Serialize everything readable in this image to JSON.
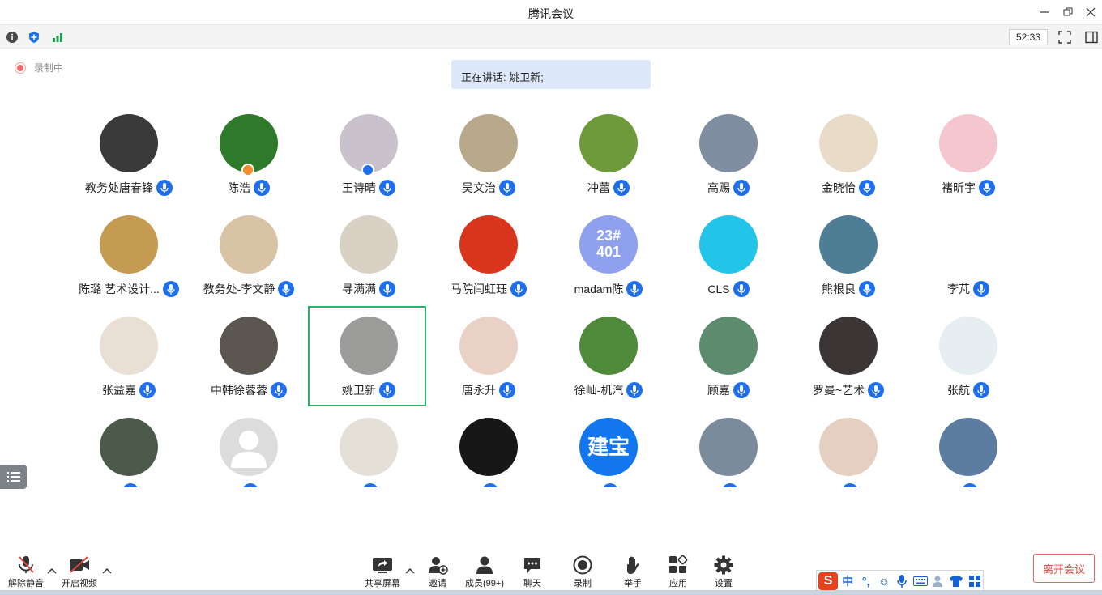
{
  "window": {
    "title": "腾讯会议"
  },
  "infobar": {
    "timer": "52:33"
  },
  "recording": {
    "label": "录制中"
  },
  "speaking": {
    "text": "正在讲话: 姚卫新;"
  },
  "participants": [
    {
      "name": "教务处唐春锋",
      "avatar_color": "#3a3a3a"
    },
    {
      "name": "陈浩",
      "avatar_color": "#2f7a2a",
      "badge": "host"
    },
    {
      "name": "王诗晴",
      "avatar_color": "#c9c2cc",
      "badge": "cohost"
    },
    {
      "name": "吴文治",
      "avatar_color": "#b7a98a"
    },
    {
      "name": "冲蕾",
      "avatar_color": "#6e9a3c"
    },
    {
      "name": "高赐",
      "avatar_color": "#7f8ea1"
    },
    {
      "name": "金晓怡",
      "avatar_color": "#e8dcc9"
    },
    {
      "name": "褚昕宇",
      "avatar_color": "#f4c7cf"
    },
    {
      "name": "陈璐 艺术设计...",
      "avatar_color": "#c59a52"
    },
    {
      "name": "教务处-李文静",
      "avatar_color": "#d8c3a5"
    },
    {
      "name": "寻满满",
      "avatar_color": "#d9d1c4"
    },
    {
      "name": "马院闫虹珏",
      "avatar_color": "#d9351c"
    },
    {
      "name": "madam陈",
      "avatar_color": "#8fa1ee",
      "avatar_text": "23# 401"
    },
    {
      "name": "CLS",
      "avatar_color": "#22c4e8"
    },
    {
      "name": "熊根良",
      "avatar_color": "#4d7e96"
    },
    {
      "name": "李芃",
      "avatar_color": "#ffffff"
    },
    {
      "name": "张益嘉",
      "avatar_color": "#e9dfd4"
    },
    {
      "name": "中韩徐蓉蓉",
      "avatar_color": "#5b5750"
    },
    {
      "name": "姚卫新",
      "avatar_color": "#9c9c9a",
      "active": true
    },
    {
      "name": "唐永升",
      "avatar_color": "#e9d2c5"
    },
    {
      "name": "徐屾-机汽",
      "avatar_color": "#4f8a3a"
    },
    {
      "name": "顾嘉",
      "avatar_color": "#5d8b6d"
    },
    {
      "name": "罗曼~艺术",
      "avatar_color": "#3b3535"
    },
    {
      "name": "张航",
      "avatar_color": "#e7eef2"
    },
    {
      "name": "",
      "avatar_color": "#4c5a4b"
    },
    {
      "name": "",
      "avatar_color": "#dcdcdc"
    },
    {
      "name": "",
      "avatar_color": "#e4e0d8"
    },
    {
      "name": "",
      "avatar_color": "#171717"
    },
    {
      "name": "",
      "avatar_color": "#1277ef",
      "avatar_text": "建宝"
    },
    {
      "name": "",
      "avatar_color": "#7a8c9b"
    },
    {
      "name": "",
      "avatar_color": "#e5cfc1"
    },
    {
      "name": "",
      "avatar_color": "#5c7da0"
    }
  ],
  "toolbar": {
    "unmute": "解除静音",
    "start_video": "开启视频",
    "share_screen": "共享屏幕",
    "invite": "邀请",
    "members": "成员(99+)",
    "chat": "聊天",
    "record": "录制",
    "raise_hand": "举手",
    "apps": "应用",
    "settings": "设置",
    "leave": "离开会议"
  },
  "ime": {
    "logo": "S",
    "mode": "中",
    "punct": "°,"
  },
  "colors": {
    "accent": "#1e6ff0",
    "active_border": "#27b36a",
    "leave": "#e0453c"
  }
}
